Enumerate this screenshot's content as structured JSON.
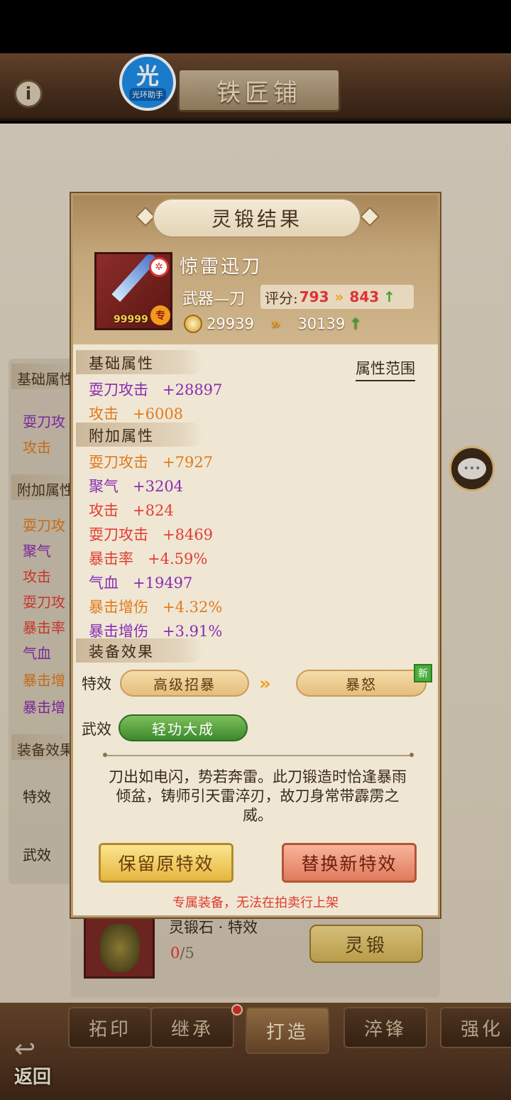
{
  "header": {
    "title": "铁匠铺",
    "assistant_glyph": "光",
    "assistant_label": "光环助手"
  },
  "background": {
    "sections": [
      "基础属性",
      "附加属性",
      "装备效果"
    ],
    "base_lines": [
      "耍刀攻",
      "攻击"
    ],
    "extra_lines": [
      "耍刀攻",
      "聚气",
      "攻击",
      "耍刀攻",
      "暴击率",
      "气血",
      "暴击增",
      "暴击增"
    ],
    "effect_labels": [
      "特效",
      "武效"
    ],
    "material": {
      "name": "灵锻石 · 特效",
      "count_have": "0",
      "count_need": "/5",
      "action": "灵锻"
    }
  },
  "tabs": [
    "拓印",
    "继承",
    "打造",
    "淬锋",
    "强化"
  ],
  "back_label": "返回",
  "modal": {
    "title": "灵锻结果",
    "weapon": {
      "name": "惊雷迅刀",
      "type": "武器—刀",
      "level_text": "99999",
      "score_label": "评分:",
      "score_old": "793",
      "score_new": "843",
      "power_old": "29939",
      "power_new": "30139"
    },
    "range_link": "属性范围",
    "base_title": "基础属性",
    "base_attrs": [
      {
        "name": "耍刀攻击",
        "value": "+28897",
        "color": "purple"
      },
      {
        "name": "攻击",
        "value": "+6008",
        "color": "orange"
      }
    ],
    "extra_title": "附加属性",
    "extra_attrs": [
      {
        "name": "耍刀攻击",
        "value": "+7927",
        "color": "orange"
      },
      {
        "name": "聚气",
        "value": "+3204",
        "color": "purple"
      },
      {
        "name": "攻击",
        "value": "+824",
        "color": "red"
      },
      {
        "name": "耍刀攻击",
        "value": "+8469",
        "color": "red"
      },
      {
        "name": "暴击率",
        "value": "+4.59%",
        "color": "red"
      },
      {
        "name": "气血",
        "value": "+19497",
        "color": "purple"
      },
      {
        "name": "暴击增伤",
        "value": "+4.32%",
        "color": "orange"
      },
      {
        "name": "暴击增伤",
        "value": "+3.91%",
        "color": "purple"
      }
    ],
    "effect_title": "装备效果",
    "special_label": "特效",
    "special_old": "高级招暴",
    "special_new": "暴怒",
    "new_badge": "新",
    "martial_label": "武效",
    "martial_value": "轻功大成",
    "description": "刀出如电闪，势若奔雷。此刀锻造时恰逢暴雨倾盆，铸师引天雷淬刃，故刀身常带霹雳之威。",
    "keep_button": "保留原特效",
    "replace_button": "替换新特效",
    "warning": "专属装备，无法在拍卖行上架"
  }
}
